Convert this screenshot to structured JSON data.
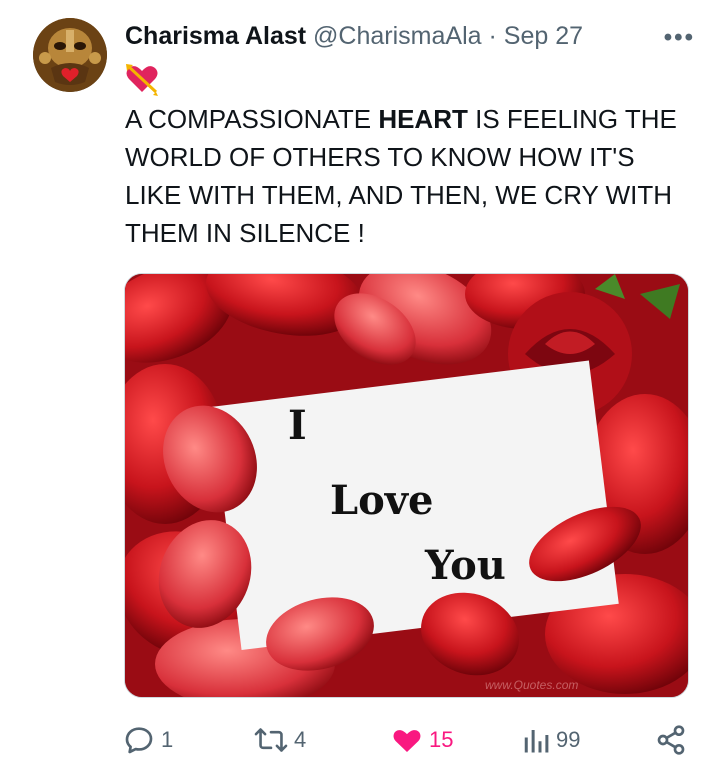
{
  "post": {
    "author_name": "Charisma Alast",
    "author_handle": "@CharismaAla",
    "separator": "·",
    "date": "Sep 27",
    "more_label": "•••",
    "emoji": "💘",
    "text_before": "A COMPASSIONATE ",
    "text_bold": "HEART",
    "text_after": " IS FEELING THE WORLD OF OTHERS TO KNOW HOW IT'S LIKE WITH THEM, AND THEN, WE CRY WITH THEM IN SILENCE !"
  },
  "media": {
    "card_lines": [
      "I",
      "Love",
      "You"
    ],
    "watermark": "www.Quotes.com"
  },
  "actions": {
    "replies": "1",
    "reposts": "4",
    "likes": "15",
    "views": "99"
  },
  "colors": {
    "like_active": "#f91880",
    "muted": "#536471",
    "rose": "#b5121b"
  },
  "icons": [
    "reply-icon",
    "repost-icon",
    "heart-icon",
    "views-icon",
    "share-icon",
    "more-icon"
  ]
}
